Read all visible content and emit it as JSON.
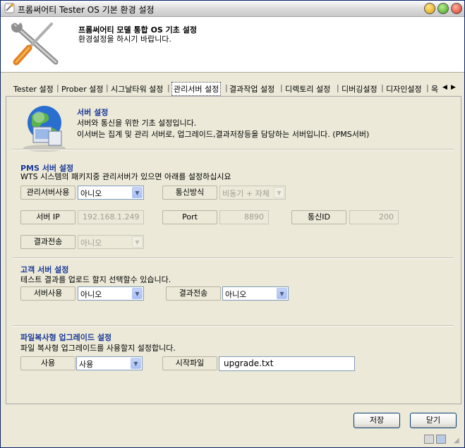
{
  "window": {
    "title": "프롬써어티 Tester OS 기본 환경 설정"
  },
  "header": {
    "title": "프롬써어티 모델 통합 OS 기초 설정",
    "desc": "환경설정을 하시기 바랍니다."
  },
  "tabs": [
    {
      "label": "Tester 설정"
    },
    {
      "label": "Prober 설정"
    },
    {
      "label": "시그날타워 설정"
    },
    {
      "label": "관리서버 설정",
      "active": true
    },
    {
      "label": "결과작업 설정"
    },
    {
      "label": "디렉토리 설정"
    },
    {
      "label": "디버깅설정"
    },
    {
      "label": "디자인설정"
    },
    {
      "label": "옥"
    }
  ],
  "server": {
    "heading": "서버 설정",
    "line1": "서버와 통신을 위한 기초 설정입니다.",
    "line2": "이서버는 집계 및 관리 서버로, 업그레이드,결과저장등을 담당하는 서버입니다. (PMS서버)"
  },
  "pms": {
    "heading": "PMS 서버 설정",
    "desc": "WTS 시스템의 패키지중 관리서버가 있으면 아래를 설정하십시요",
    "use_label": "관리서버사용",
    "use_value": "아니오",
    "comm_label": "통신방식",
    "comm_value": "비동기 + 자체",
    "ip_label": "서버 IP",
    "ip_value": "192.168.1.249",
    "port_label": "Port",
    "port_value": "8890",
    "id_label": "통신ID",
    "id_value": "200",
    "send_label": "결과전송",
    "send_value": "아니오"
  },
  "customer": {
    "heading": "고객 서버 설정",
    "desc": "테스트 결과를 업로드 할지 선택할수 있습니다.",
    "use_label": "서버사용",
    "use_value": "아니오",
    "send_label": "결과전송",
    "send_value": "아니오"
  },
  "upgrade": {
    "heading": "파일복사형 업그레이드 설정",
    "desc": "파일 복사형 업그레이드를 사용할지 설정합니다.",
    "use_label": "사용",
    "use_value": "사용",
    "file_label": "시작파일",
    "file_value": "upgrade.txt"
  },
  "footer": {
    "save": "저장",
    "close": "닫기"
  },
  "colors": {
    "section_heading": "#1a3a98",
    "window_bg": "#ece9d8"
  }
}
